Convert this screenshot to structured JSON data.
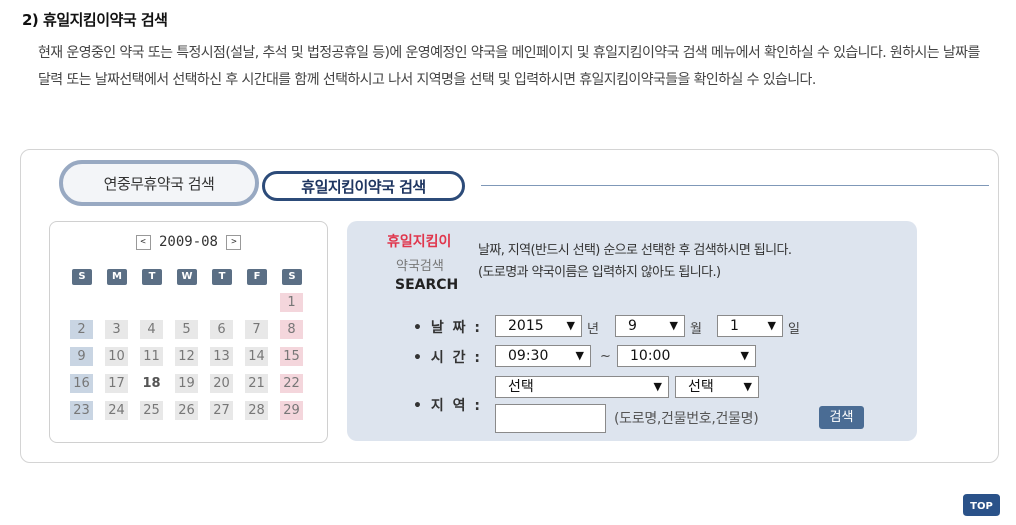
{
  "section_title": "2) 휴일지킴이약국 검색",
  "description": "현재 운영중인 약국 또는 특정시점(설날, 추석 및 법정공휴일 등)에 운영예정인 약국을 메인페이지 및 휴일지킴이약국 검색 메뉴에서 확인하실 수 있습니다. 원하시는 날짜를 달력 또는 날짜선택에서 선택하신 후 시간대를 함께 선택하시고 나서 지역명을 선택 및 입력하시면 휴일지킴이약국들을 확인하실 수 있습니다.",
  "tabs": {
    "tab1": "연중무휴약국 검색",
    "tab2": "휴일지킴이약국 검색"
  },
  "calendar": {
    "prev": "<",
    "next": ">",
    "month": "2009-08",
    "weekdays": [
      "S",
      "M",
      "T",
      "W",
      "T",
      "F",
      "S"
    ],
    "rows": [
      [
        "",
        "",
        "",
        "",
        "",
        "",
        "1"
      ],
      [
        "2",
        "3",
        "4",
        "5",
        "6",
        "7",
        "8"
      ],
      [
        "9",
        "10",
        "11",
        "12",
        "13",
        "14",
        "15"
      ],
      [
        "16",
        "17",
        "18",
        "19",
        "20",
        "21",
        "22"
      ],
      [
        "23",
        "24",
        "25",
        "26",
        "27",
        "28",
        "29"
      ]
    ],
    "highlight": "18"
  },
  "search": {
    "logo_line1": "휴일지킴이",
    "logo_line2": "약국검색",
    "logo_line3": "SEARCH",
    "hint_line1": "날짜, 지역(반드시 선택) 순으로 선택한 후 검색하시면 됩니다.",
    "hint_line2": "(도로명과 약국이름은 입력하지 않아도 됩니다.)",
    "date_label": "• 날 짜 :",
    "year": "2015",
    "year_unit": "년",
    "month": "9",
    "month_unit": "월",
    "day": "1",
    "day_unit": "일",
    "time_label": "• 시 간 :",
    "time_from": "09:30",
    "time_sep": "~",
    "time_to": "10:00",
    "region_label": "• 지 역 :",
    "region1": "선택",
    "region2": "선택",
    "input_value": "",
    "input_note": "(도로명,건물번호,건물명)",
    "button": "검색"
  },
  "top_button": "TOP",
  "colors": {
    "accent": "#2c4b79",
    "red": "#e0364c",
    "panel_bg": "#dde4ee"
  }
}
